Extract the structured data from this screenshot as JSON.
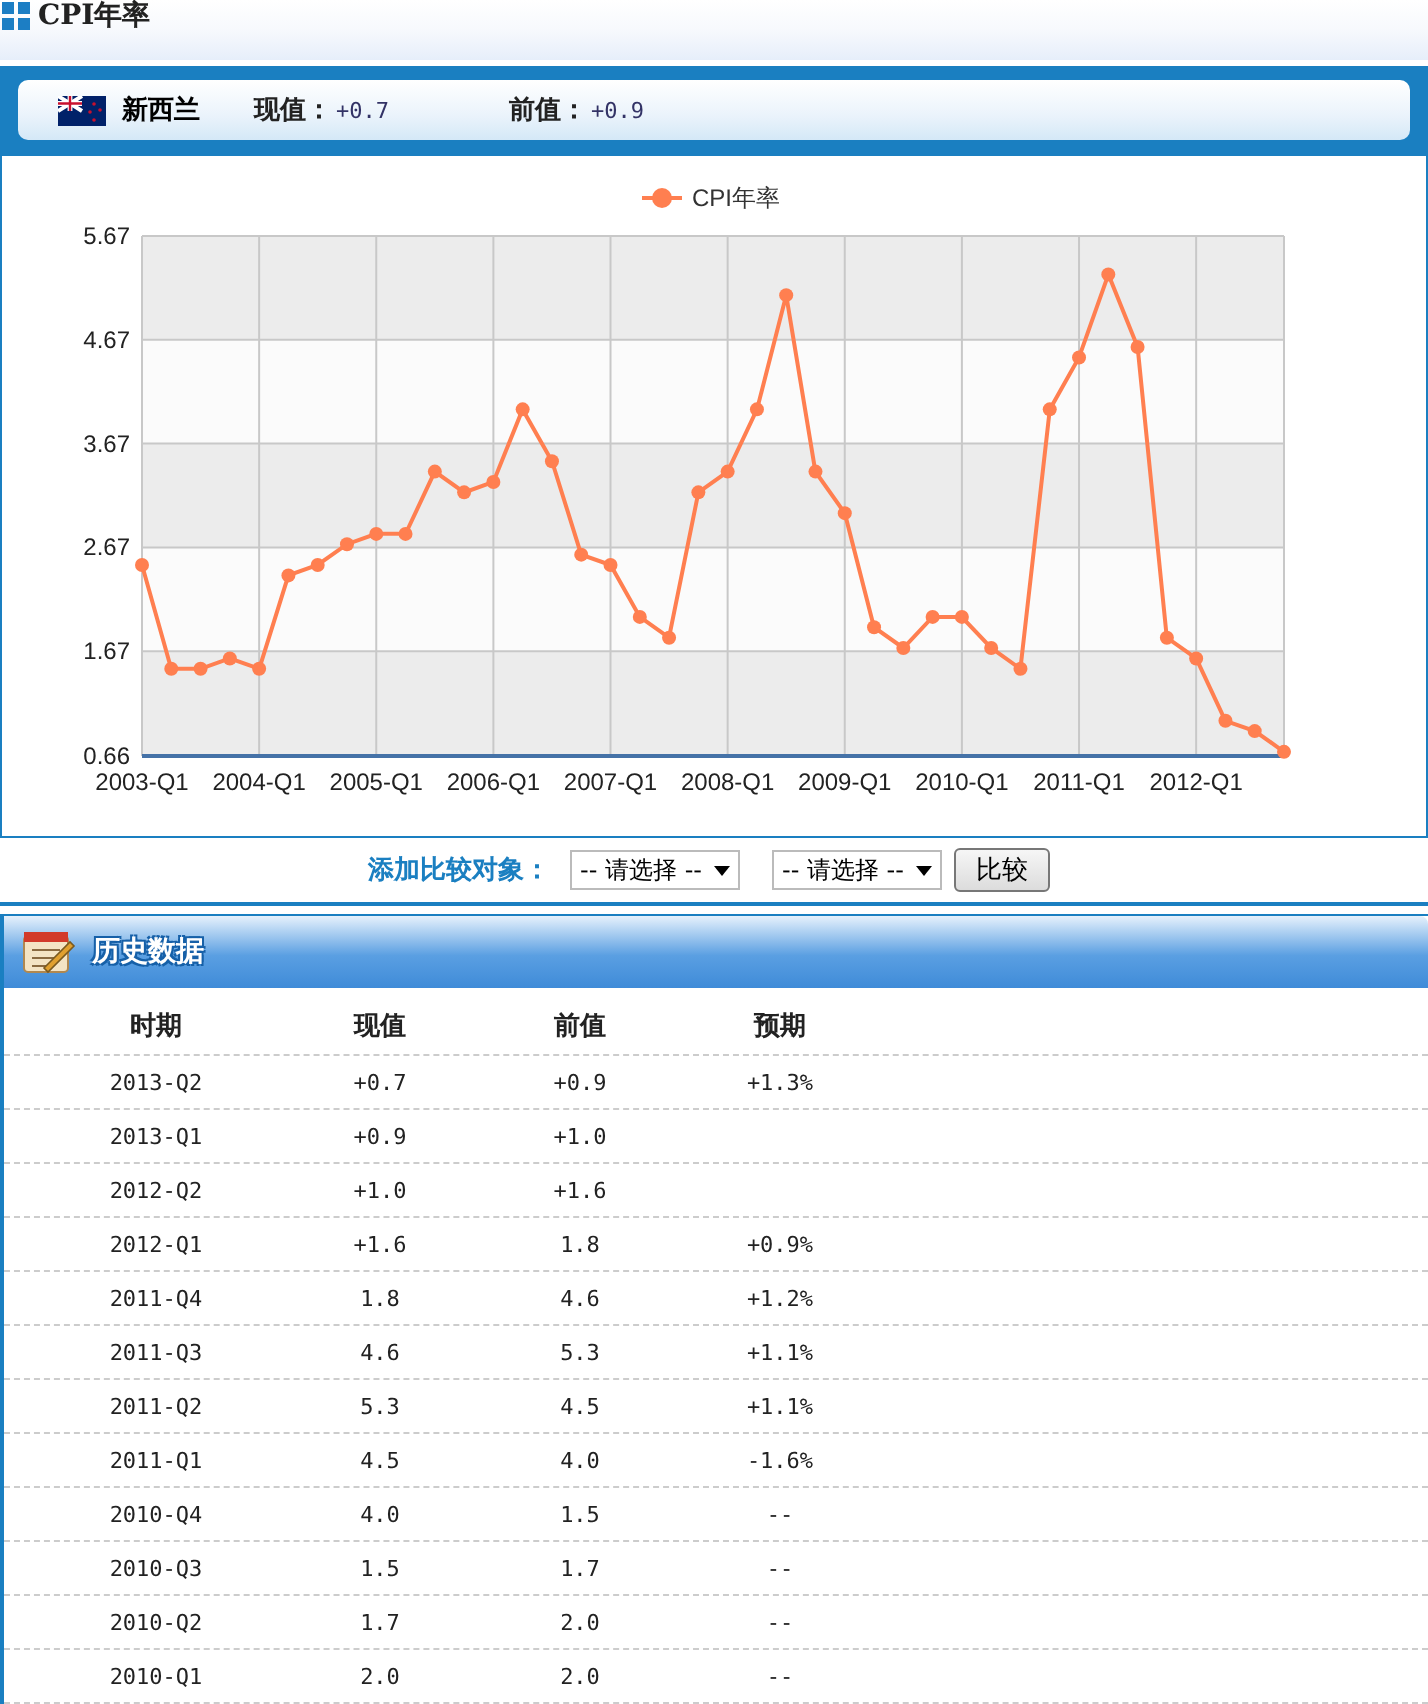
{
  "page_title": "CPI年率",
  "country": {
    "name": "新西兰",
    "current_label": "现值：",
    "current": "+0.7",
    "previous_label": "前值：",
    "previous": "+0.9"
  },
  "chart": {
    "chart_data": {
      "type": "line",
      "grid": true,
      "categories": [
        "2003-Q1",
        null,
        null,
        null,
        "2004-Q1",
        null,
        null,
        null,
        "2005-Q1",
        null,
        null,
        null,
        "2006-Q1",
        null,
        null,
        null,
        "2007-Q1",
        null,
        null,
        null,
        "2008-Q1",
        null,
        null,
        null,
        "2009-Q1",
        null,
        null,
        null,
        "2010-Q1",
        null,
        null,
        null,
        "2011-Q1",
        null,
        null,
        null,
        "2012-Q1",
        null,
        null,
        null
      ],
      "series": [
        {
          "name": "CPI年率",
          "color": "#ff7f50",
          "marker": "circle",
          "values": [
            2.5,
            1.5,
            1.5,
            1.6,
            1.5,
            2.4,
            2.5,
            2.7,
            2.8,
            2.8,
            3.4,
            3.2,
            3.3,
            4.0,
            3.5,
            2.6,
            2.5,
            2.0,
            1.8,
            3.2,
            3.4,
            4.0,
            5.1,
            3.4,
            3.0,
            1.9,
            1.7,
            2.0,
            2.0,
            1.7,
            1.5,
            4.0,
            4.5,
            5.3,
            4.6,
            1.8,
            1.6,
            1.0,
            0.9,
            0.7
          ]
        }
      ],
      "ylim": [
        0.66,
        5.67
      ],
      "yticks": [
        0.66,
        1.67,
        2.67,
        3.67,
        4.67,
        5.67
      ]
    }
  },
  "compare": {
    "label": "添加比较对象：",
    "selects": [
      "-- 请选择 --",
      "-- 请选择 --"
    ],
    "button": "比较"
  },
  "history": {
    "title": "历史数据",
    "columns": [
      "时期",
      "现值",
      "前值",
      "预期"
    ],
    "rows": [
      [
        "2013-Q2",
        "+0.7",
        "+0.9",
        "+1.3%"
      ],
      [
        "2013-Q1",
        "+0.9",
        "+1.0",
        ""
      ],
      [
        "2012-Q2",
        "+1.0",
        "+1.6",
        ""
      ],
      [
        "2012-Q1",
        "+1.6",
        "1.8",
        "+0.9%"
      ],
      [
        "2011-Q4",
        "1.8",
        "4.6",
        "+1.2%"
      ],
      [
        "2011-Q3",
        "4.6",
        "5.3",
        "+1.1%"
      ],
      [
        "2011-Q2",
        "5.3",
        "4.5",
        "+1.1%"
      ],
      [
        "2011-Q1",
        "4.5",
        "4.0",
        "-1.6%"
      ],
      [
        "2010-Q4",
        "4.0",
        "1.5",
        "--"
      ],
      [
        "2010-Q3",
        "1.5",
        "1.7",
        "--"
      ],
      [
        "2010-Q2",
        "1.7",
        "2.0",
        "--"
      ],
      [
        "2010-Q1",
        "2.0",
        "2.0",
        "--"
      ]
    ]
  }
}
